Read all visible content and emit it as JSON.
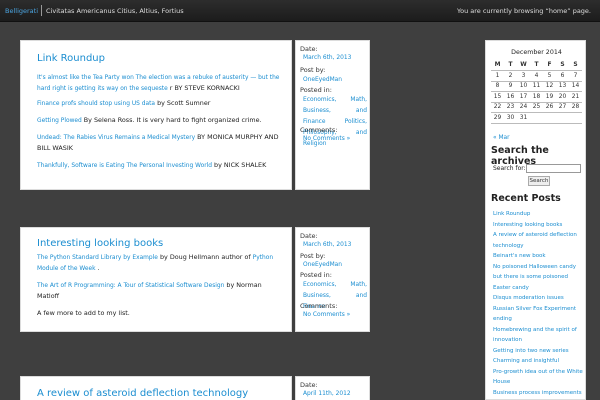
{
  "topbar": {
    "site_name": "Belligerati",
    "tagline": "Civitatas Americanus Citius, Altius, Fortius",
    "browsing": "You are currently browsing “home” page."
  },
  "posts": [
    {
      "title": "Link Roundup",
      "lines": [
        [
          {
            "t": "It's almost like the Tea Party won The election was a rebuke of austerity — but the",
            "l": 1
          }
        ],
        [
          {
            "t": "hard right is getting its way on the sequeste",
            "l": 1
          },
          {
            "t": " r BY STEVE KORNACKI",
            "l": 0
          }
        ],
        [
          {
            "t": "Finance profs should stop using US data",
            "l": 1
          },
          {
            "t": "  by Scott Sumner",
            "l": 0
          }
        ],
        [
          {
            "t": "Getting Plowed",
            "l": 1
          },
          {
            "t": "   By Selena Ross. It is very hard to fight organized crime.",
            "l": 0
          }
        ],
        [
          {
            "t": "Undead: The Rabies Virus Remains a Medical Mystery",
            "l": 1
          },
          {
            "t": "   BY MONICA MURPHY AND",
            "l": 0
          }
        ],
        [
          {
            "t": "BILL WASIK",
            "l": 0
          }
        ],
        [
          {
            "t": "Thankfully, Software is Eating The Personal Investing World",
            "l": 1
          },
          {
            "t": "   by NICK SHALEK",
            "l": 0
          }
        ]
      ],
      "meta": {
        "date_label": "Date:",
        "date": "March 6th, 2013",
        "post_by_label": "Post by:",
        "author": "OneEyedMan",
        "posted_in_label": "Posted in:",
        "categories": "Economics, Math, Business, and Finance Politics, Philosophy, and Religion",
        "comments_label": "Comments:",
        "comments": "No Comments »"
      }
    },
    {
      "title": "Interesting looking books",
      "lines": [
        [
          {
            "t": "The Python Standard Library by Example",
            "l": 1
          },
          {
            "t": "  by Doug Hellmann author of ",
            "l": 0
          },
          {
            "t": "Python",
            "l": 1
          }
        ],
        [
          {
            "t": "Module of the Week",
            "l": 1
          },
          {
            "t": " .",
            "l": 0
          }
        ],
        [
          {
            "t": "The Art of R Programming: A Tour of Statistical Software Design",
            "l": 1
          },
          {
            "t": "  by Norman",
            "l": 0
          }
        ],
        [
          {
            "t": "Matloff",
            "l": 0
          }
        ],
        [
          {
            "t": "A few  more to add to my list.",
            "l": 0
          }
        ]
      ],
      "meta": {
        "date_label": "Date:",
        "date": "March 6th, 2013",
        "post_by_label": "Post by:",
        "author": "OneEyedMan",
        "posted_in_label": "Posted in:",
        "categories": "Economics, Math, Business, and Finance",
        "comments_label": "Comments:",
        "comments": "No Comments »"
      }
    },
    {
      "title": "A review of asteroid deflection technology",
      "lines": [],
      "meta": {
        "date_label": "Date:",
        "date": "April 11th, 2012"
      }
    }
  ],
  "sidebar": {
    "calendar": {
      "caption": "December 2014",
      "weekdays": [
        "M",
        "T",
        "W",
        "T",
        "F",
        "S",
        "S"
      ],
      "weeks": [
        [
          "1",
          "2",
          "3",
          "4",
          "5",
          "6",
          "7"
        ],
        [
          "8",
          "9",
          "10",
          "11",
          "12",
          "13",
          "14"
        ],
        [
          "15",
          "16",
          "17",
          "18",
          "19",
          "20",
          "21"
        ],
        [
          "22",
          "23",
          "24",
          "25",
          "26",
          "27",
          "28"
        ],
        [
          "29",
          "30",
          "31",
          "",
          "",
          "",
          ""
        ]
      ],
      "prev": "« Mar"
    },
    "search": {
      "heading": "Search the archives",
      "label": "Search for:",
      "value": "",
      "button": "Search"
    },
    "recent": {
      "heading": "Recent Posts",
      "items": [
        "Link Roundup",
        "Interesting looking books",
        "A review of asteroid deflection technology",
        "Beinart's new book",
        "No poisoned Halloween candy but there is some poisoned Easter candy",
        "Disqus moderation issues",
        "Russian Silver Fox Experiment ending",
        "Homebrewing and the spirit of innovation",
        "Getting into two new series",
        "Charming and insightful",
        "Pro-growth idea out of the White House",
        "Business process improvements are technological innovations"
      ]
    }
  },
  "colors": {
    "link": "#1a8dd0",
    "background": "#3f3f3f",
    "topbar": "#222222"
  }
}
